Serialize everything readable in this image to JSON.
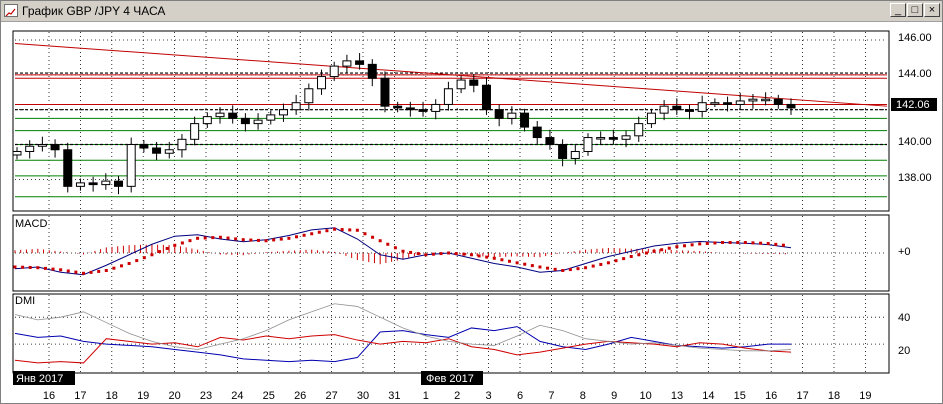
{
  "window": {
    "title": "График GBP /JPY  4 ЧАСА",
    "minimize_glyph": "_",
    "maximize_glyph": "□",
    "close_glyph": "×",
    "app_icon": "chart-icon"
  },
  "price_panel": {
    "current_price_label": "142.06",
    "y_ticks": [
      "146.00",
      "144.00",
      "142.00",
      "140.00",
      "138.00"
    ]
  },
  "macd_panel": {
    "label": "MACD",
    "zero_label": "+0"
  },
  "dmi_panel": {
    "label": "DMI",
    "y_ticks": [
      "40",
      "20"
    ]
  },
  "x_axis": {
    "day_labels": [
      "16",
      "17",
      "18",
      "19",
      "20",
      "23",
      "24",
      "25",
      "26",
      "27",
      "30",
      "31",
      "1",
      "2",
      "3",
      "6",
      "7",
      "8",
      "9",
      "10",
      "13",
      "14",
      "15",
      "16",
      "17",
      "18",
      "19"
    ],
    "month_markers": [
      "Янв 2017",
      "Фев 2017"
    ]
  },
  "colors": {
    "candle": "#000000",
    "trendline": "#c00000",
    "resistance": "#c00000",
    "support": "#008000",
    "macd_line": "#000080",
    "signal_dots": "#cc0000",
    "plus_di": "#0000b0",
    "minus_di": "#d00000",
    "adx": "#909090",
    "label_bg": "#000000"
  },
  "chart_data": [
    {
      "type": "candlestick",
      "title": "График GBP /JPY  4 ЧАСА",
      "x": [
        "16",
        "17",
        "18",
        "19",
        "20",
        "23",
        "24",
        "25",
        "26",
        "27",
        "30",
        "31",
        "1",
        "2",
        "3",
        "6",
        "7",
        "8",
        "9",
        "10",
        "13",
        "14",
        "15",
        "16",
        "17",
        "18",
        "19"
      ],
      "ylim": [
        136.3,
        146.4
      ],
      "y_ticks": [
        146,
        144,
        142,
        140,
        138
      ],
      "current_price": 142.06,
      "close_path": [
        139.6,
        139.9,
        140.0,
        139.7,
        137.6,
        137.8,
        137.7,
        137.9,
        137.6,
        140.0,
        139.8,
        139.5,
        139.7,
        140.3,
        141.2,
        141.6,
        141.8,
        141.5,
        141.2,
        141.4,
        141.7,
        142.0,
        142.4,
        143.2,
        143.9,
        144.5,
        144.8,
        144.6,
        143.8,
        142.2,
        142.1,
        142.0,
        141.9,
        142.3,
        143.2,
        143.7,
        143.4,
        142.0,
        141.5,
        141.8,
        141.0,
        140.4,
        140.0,
        139.2,
        139.6,
        140.4,
        140.4,
        140.3,
        140.5,
        141.2,
        141.8,
        142.2,
        142.0,
        141.9,
        142.4,
        142.4,
        142.3,
        142.5,
        142.6,
        142.6,
        142.3,
        142.1
      ],
      "horizontal_levels": [
        {
          "value": 144.0,
          "color": "resistance"
        },
        {
          "value": 143.8,
          "color": "resistance"
        },
        {
          "value": 142.3,
          "color": "resistance"
        },
        {
          "value": 141.5,
          "color": "support"
        },
        {
          "value": 140.8,
          "color": "support"
        },
        {
          "value": 140.0,
          "color": "support"
        },
        {
          "value": 139.1,
          "color": "support"
        },
        {
          "value": 138.2,
          "color": "support"
        },
        {
          "value": 137.0,
          "color": "support"
        }
      ],
      "dotted_levels": [
        144.1,
        142.0,
        140.0
      ],
      "trendline": {
        "from": 145.8,
        "to": 142.2
      }
    },
    {
      "type": "line",
      "title": "MACD",
      "zero_label": "+0",
      "ylim": [
        -1.0,
        1.0
      ],
      "series": [
        {
          "values": [
            -0.45,
            -0.4,
            -0.55,
            -0.62,
            -0.35,
            -0.05,
            0.25,
            0.48,
            0.52,
            0.4,
            0.32,
            0.38,
            0.5,
            0.66,
            0.72,
            0.4,
            -0.05,
            -0.18,
            -0.05,
            0.0,
            -0.15,
            -0.3,
            -0.4,
            -0.55,
            -0.5,
            -0.3,
            -0.1,
            0.05,
            0.2,
            0.28,
            0.33,
            0.3,
            0.28,
            0.24,
            0.15
          ]
        },
        {
          "values": [
            -0.4,
            -0.42,
            -0.48,
            -0.58,
            -0.5,
            -0.3,
            -0.05,
            0.22,
            0.42,
            0.45,
            0.38,
            0.35,
            0.42,
            0.55,
            0.68,
            0.65,
            0.35,
            0.05,
            -0.05,
            0.0,
            -0.05,
            -0.15,
            -0.28,
            -0.4,
            -0.5,
            -0.42,
            -0.28,
            -0.1,
            0.05,
            0.18,
            0.26,
            0.3,
            0.3,
            0.27,
            0.2
          ]
        },
        {
          "values": [
            0.1,
            0.15,
            0.05,
            -0.05,
            0.2,
            0.28,
            0.3,
            0.28,
            0.12,
            -0.05,
            -0.08,
            0.03,
            0.08,
            0.12,
            0.04,
            -0.25,
            -0.4,
            -0.23,
            0.0,
            0.0,
            -0.1,
            -0.15,
            -0.12,
            -0.15,
            0.0,
            0.12,
            0.18,
            0.15,
            0.15,
            0.1,
            0.07,
            0.0,
            -0.02,
            -0.03,
            -0.05
          ]
        }
      ]
    },
    {
      "type": "line",
      "title": "DMI",
      "ylim": [
        0,
        55
      ],
      "y_ticks": [
        40,
        20
      ],
      "series": [
        {
          "values": [
            28,
            25,
            26,
            22,
            20,
            19,
            18,
            16,
            14,
            12,
            9,
            8,
            7,
            8,
            7,
            10,
            29,
            30,
            27,
            25,
            32,
            30,
            33,
            22,
            18,
            16,
            20,
            25,
            22,
            19,
            18,
            17,
            18,
            20,
            20
          ]
        },
        {
          "values": [
            8,
            6,
            7,
            6,
            24,
            22,
            20,
            21,
            18,
            25,
            23,
            26,
            24,
            26,
            27,
            23,
            20,
            22,
            21,
            24,
            18,
            16,
            12,
            14,
            17,
            20,
            22,
            21,
            20,
            18,
            21,
            20,
            17,
            15,
            14
          ]
        },
        {
          "values": [
            42,
            38,
            40,
            44,
            36,
            28,
            22,
            18,
            16,
            20,
            24,
            30,
            38,
            44,
            50,
            48,
            40,
            32,
            26,
            22,
            20,
            19,
            26,
            34,
            30,
            24,
            22,
            20,
            21,
            19,
            17,
            16,
            15,
            15,
            16
          ]
        }
      ]
    }
  ]
}
